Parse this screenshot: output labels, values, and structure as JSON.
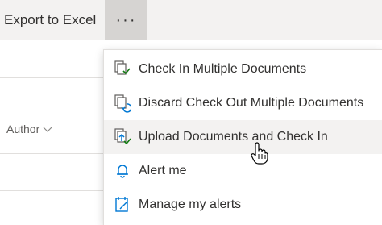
{
  "toolbar": {
    "export_label": "Export to Excel",
    "more_label": "···",
    "more_icon": "more-horizontal-icon"
  },
  "columns": {
    "author_label": "Author",
    "author_icon": "chevron-down-icon"
  },
  "menu": {
    "items": [
      {
        "label": "Check In Multiple Documents",
        "icon": "check-in-documents-icon"
      },
      {
        "label": "Discard Check Out Multiple Documents",
        "icon": "discard-checkout-icon"
      },
      {
        "label": "Upload Documents and Check In",
        "icon": "upload-checkin-icon"
      },
      {
        "label": "Alert me",
        "icon": "bell-icon"
      },
      {
        "label": "Manage my alerts",
        "icon": "edit-alert-icon"
      }
    ],
    "hovered_index": 2
  },
  "colors": {
    "toolbar_bg": "#f3f2f1",
    "more_button_bg": "#d6d4d2",
    "accent_blue": "#0078d4",
    "accent_green": "#107c10",
    "hover_bg": "#f3f2f1"
  }
}
